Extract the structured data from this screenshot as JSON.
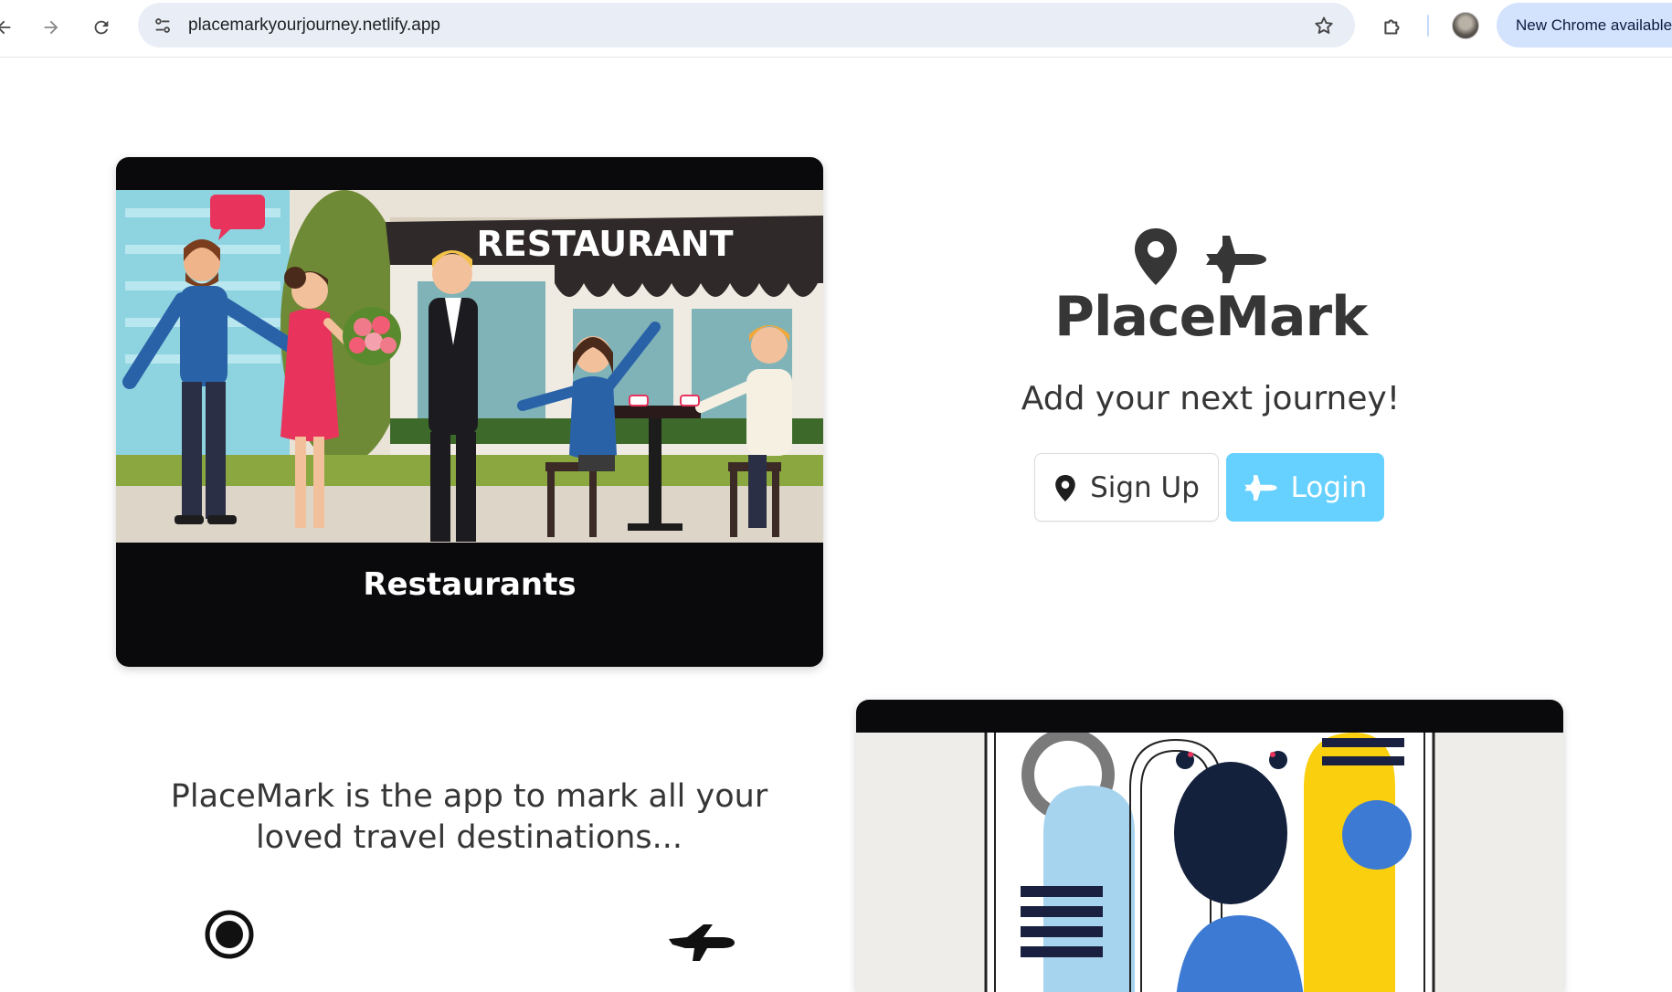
{
  "browser": {
    "url": "placemarkyourjourney.netlify.app",
    "update_label": "New Chrome available"
  },
  "icons": {
    "back": "arrow-left-icon",
    "forward": "arrow-right-icon",
    "reload": "reload-icon",
    "site_info": "tune-icon",
    "bookmark": "star-icon",
    "extensions": "puzzle-icon",
    "brand_left": "map-marker-icon",
    "brand_right": "plane-icon"
  },
  "hero": {
    "title": "PlaceMark",
    "tagline": "Add your next journey!",
    "signup_label": "Sign Up",
    "login_label": "Login"
  },
  "cards": [
    {
      "caption": "Restaurants",
      "illustration_text": "RESTAURANT"
    }
  ],
  "about": {
    "text": "PlaceMark is the app to mark all your loved travel destinations..."
  },
  "colors": {
    "login_bg": "#66d1ff",
    "text_dark": "#363636",
    "card_bg": "#0a0a0c",
    "omnibox_bg": "#e9eef6",
    "update_pill_bg": "#d3e3fd"
  }
}
